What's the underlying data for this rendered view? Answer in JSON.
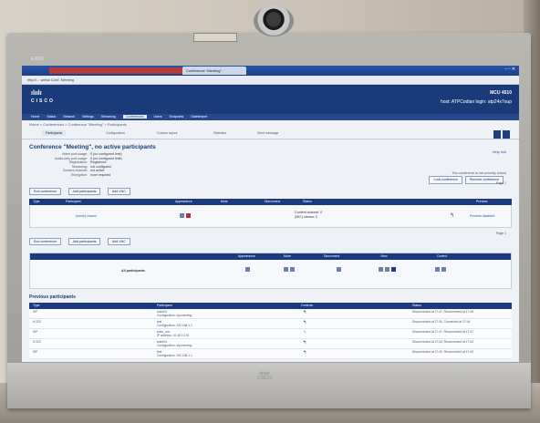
{
  "device": {
    "brand": "EX90"
  },
  "browser": {
    "tab_title": "Conference \"Meeting\"",
    "address": "http://... webui Conf. Meeting"
  },
  "header": {
    "model": "MCU 4510",
    "host": "host: ATPCodian login: atp24x7oup"
  },
  "nav": [
    "Home",
    "Status",
    "Network",
    "Settings",
    "Streaming",
    "Conferences",
    "Users",
    "Endpoints",
    "Gatekeeper",
    "Conference"
  ],
  "nav_active": "Conferences",
  "breadcrumb": "Home > Conferences > Conference \"Meeting\" > Participants",
  "subtabs": [
    "Participants",
    "Configuration",
    "Custom layout",
    "Statistics",
    "Send message"
  ],
  "page": {
    "title": "Conference \"Meeting\", no active participants",
    "help": "Help link",
    "details": [
      {
        "label": "Video port usage:",
        "value": "0 (no configured limit)"
      },
      {
        "label": "Audio-only port usage:",
        "value": "0 (no configured limit)"
      },
      {
        "label": "Registration:",
        "value": "Registered"
      },
      {
        "label": "Streaming:",
        "value": "not configured"
      },
      {
        "label": "Content channel:",
        "value": "not active"
      },
      {
        "label": "Encryption:",
        "value": "none required"
      }
    ],
    "right_note": "This conference is not currently locked",
    "buttons_top": [
      "Lock conference",
      "Remove conference"
    ]
  },
  "actions": [
    "End conference",
    "Add participants",
    "Add VNC"
  ],
  "pager": "Page 1",
  "participants_table": {
    "headers": [
      "Type",
      "Participant",
      "Appearance",
      "Mute",
      "Disconnect",
      "Status",
      "Preview"
    ],
    "row": {
      "name": "(some) closed",
      "status1": "Content channel: 0",
      "status2": "(MIC) stream: 0",
      "preview": "Preview disabled"
    }
  },
  "summary": {
    "headers": [
      "Appearance",
      "Mute",
      "Disconnect",
      "View",
      "Control"
    ],
    "label": "All participants"
  },
  "previous": {
    "title": "Previous participants",
    "headers": [
      "Type",
      "Participant",
      "Controls",
      "Status"
    ],
    "rows": [
      {
        "type": "SIP",
        "name": "sutm04",
        "sub": "Configuration: sip:meeting",
        "status": "Disconnected at 17:47, Reconnected at 17:48"
      },
      {
        "type": "H.323",
        "name": "test",
        "sub": "Configuration: 192.168.1.1",
        "status": "Disconnected at 17:46, Connected at 17:44"
      },
      {
        "type": "SIP",
        "name": "sutm_con",
        "sub": "IP address: 10.48.0.178",
        "status": "Disconnected at 17:47, Reconnected at 17:47"
      },
      {
        "type": "H.323",
        "name": "sutm04",
        "sub": "Configuration: sip:meeting",
        "status": "Disconnected at 17:44, Reconnected at 17:44"
      },
      {
        "type": "SIP",
        "name": "test",
        "sub": "Configuration: 192.168.1.1",
        "status": "Disconnected at 17:42, Reconnected at 17:40"
      }
    ]
  },
  "bezel_brand": "CISCO",
  "bezel_logo_text": "ahah"
}
